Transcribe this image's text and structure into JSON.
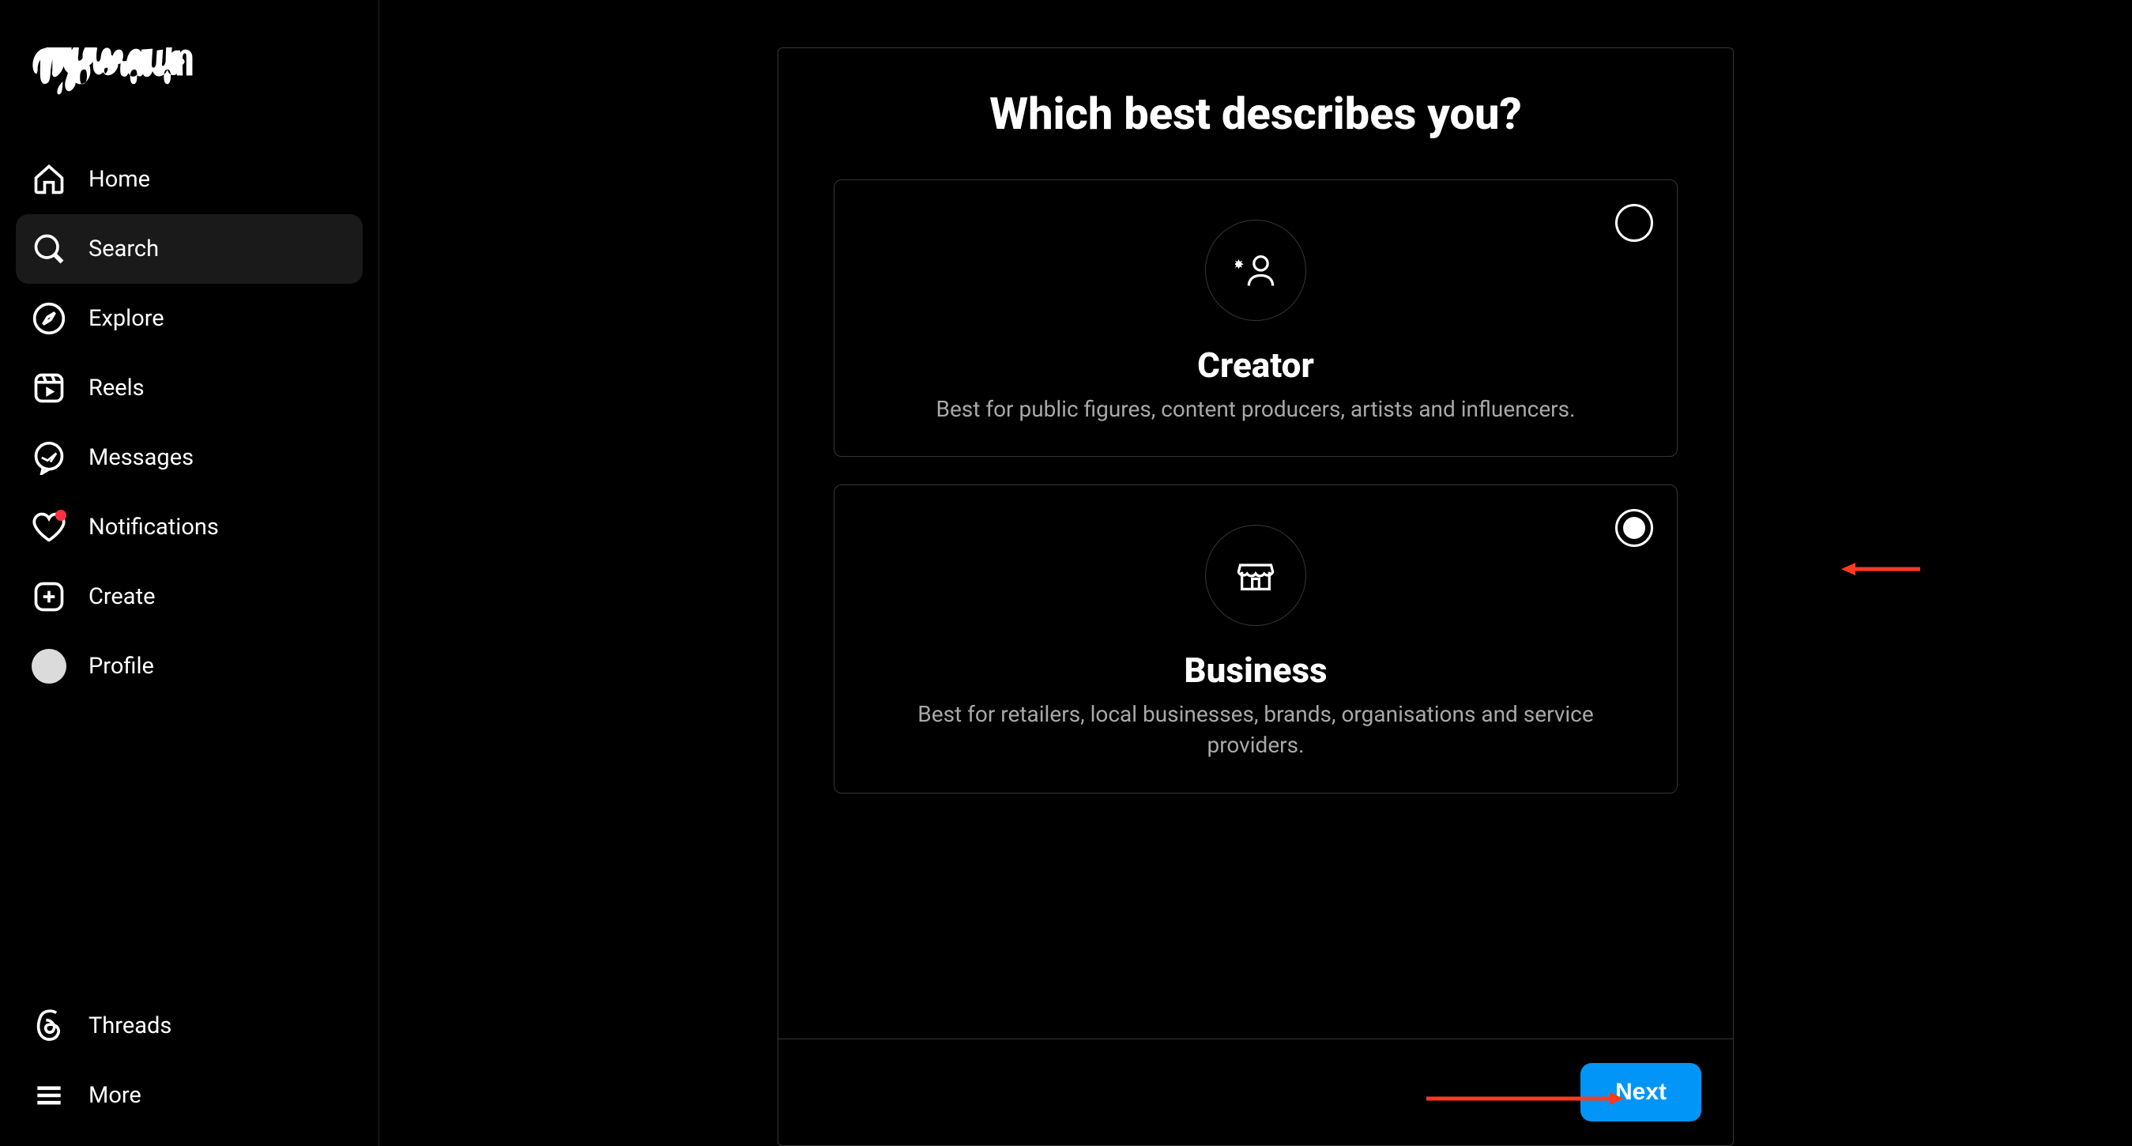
{
  "brand": "Instagram",
  "sidebar": {
    "items": [
      {
        "label": "Home",
        "icon": "home-icon"
      },
      {
        "label": "Search",
        "icon": "search-icon",
        "active": true
      },
      {
        "label": "Explore",
        "icon": "compass-icon"
      },
      {
        "label": "Reels",
        "icon": "reels-icon"
      },
      {
        "label": "Messages",
        "icon": "messages-icon"
      },
      {
        "label": "Notifications",
        "icon": "heart-icon",
        "has_dot": true
      },
      {
        "label": "Create",
        "icon": "plus-icon"
      },
      {
        "label": "Profile",
        "icon": "avatar"
      }
    ],
    "bottom_items": [
      {
        "label": "Threads",
        "icon": "threads-icon"
      },
      {
        "label": "More",
        "icon": "menu-icon"
      }
    ]
  },
  "dialog": {
    "title": "Which best describes you?",
    "options": [
      {
        "title": "Creator",
        "description": "Best for public figures, content producers, artists and influencers.",
        "selected": false
      },
      {
        "title": "Business",
        "description": "Best for retailers, local businesses, brands, organisations and service providers.",
        "selected": true
      }
    ],
    "next_button": "Next"
  }
}
